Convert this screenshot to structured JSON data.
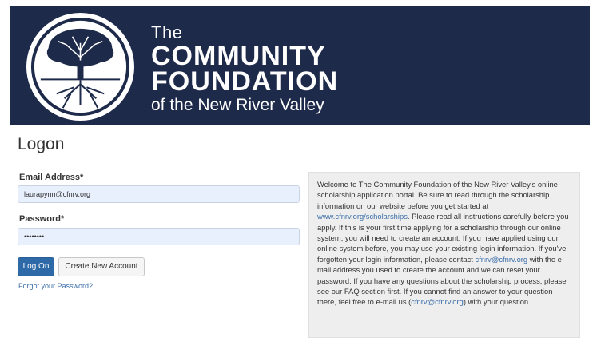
{
  "header": {
    "logo_icon": "tree-with-roots-icon",
    "brand_line1": "The",
    "brand_line2": "COMMUNITY",
    "brand_line3": "FOUNDATION",
    "brand_line4": "of the New River Valley",
    "background_color": "#1e2a4a"
  },
  "page": {
    "title": "Logon"
  },
  "form": {
    "email_label": "Email Address",
    "email_required": "*",
    "email_value": "laurapynn@cfnrv.org",
    "password_label": "Password",
    "password_required": "*",
    "password_value": "••••••••",
    "logon_button": "Log On",
    "create_account_button": "Create New Account",
    "forgot_link": "Forgot your Password?"
  },
  "info": {
    "part1": "Welcome to The Community Foundation of the New River Valley's online scholarship application portal. Be sure to read through the scholarship information on our website before you get started at ",
    "link1": "www.cfnrv.org/scholarships",
    "part2": ". Please read all instructions carefully before you apply. If this is your first time applying for a scholarship through our online system, you will need to create an account. If you have applied using our online system before, you may use your existing login information. If you've forgotten your login information, please contact ",
    "link2": "cfnrv@cfnrv.org",
    "part3": " with the e-mail address you used to create the account and we can reset your password. If you have any questions about the scholarship process, please see our FAQ section first. If you cannot find an answer to your question there, feel free to e-mail us (",
    "link3": "cfnrv@cfnrv.org",
    "part4": ") with your question."
  },
  "colors": {
    "primary_button": "#2f6aa8",
    "link": "#3b6ea8",
    "input_bg": "#e8f0fe"
  }
}
